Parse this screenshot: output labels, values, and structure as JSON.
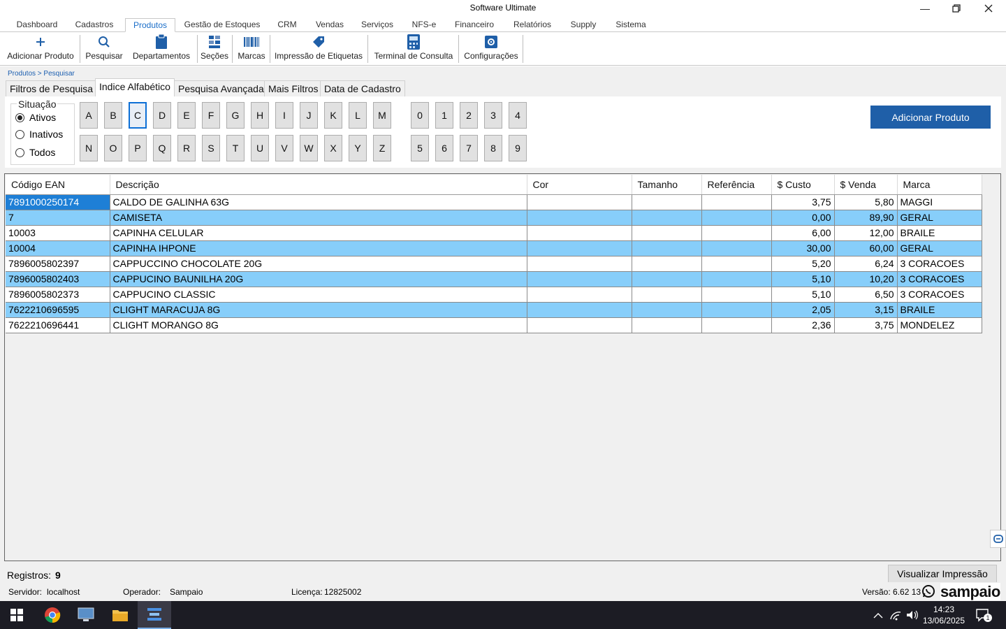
{
  "window": {
    "title": "Software Ultimate"
  },
  "menu": [
    {
      "label": "Dashboard"
    },
    {
      "label": "Cadastros"
    },
    {
      "label": "Produtos"
    },
    {
      "label": "Gestão de Estoques"
    },
    {
      "label": "CRM"
    },
    {
      "label": "Vendas"
    },
    {
      "label": "Serviços"
    },
    {
      "label": "NFS-e"
    },
    {
      "label": "Financeiro"
    },
    {
      "label": "Relatórios"
    },
    {
      "label": "Supply"
    },
    {
      "label": "Sistema"
    }
  ],
  "toolbar": [
    {
      "label": "Adicionar Produto",
      "icon": "plus-icon"
    },
    {
      "label": "Pesquisar",
      "icon": "search-icon"
    },
    {
      "label": "Departamentos",
      "icon": "clipboard-icon"
    },
    {
      "label": "Seções",
      "icon": "sections-icon"
    },
    {
      "label": "Marcas",
      "icon": "barcode-icon"
    },
    {
      "label": "Impressão de Etiquetas",
      "icon": "tag-icon"
    },
    {
      "label": "Terminal de Consulta",
      "icon": "terminal-icon"
    },
    {
      "label": "Configurações",
      "icon": "gear-icon"
    }
  ],
  "breadcrumb": "Produtos > Pesquisar",
  "subtabs": [
    {
      "label": "Filtros de Pesquisa"
    },
    {
      "label": "Indice Alfabético"
    },
    {
      "label": "Pesquisa Avançada"
    },
    {
      "label": "Mais Filtros"
    },
    {
      "label": "Data de Cadastro"
    }
  ],
  "situacao": {
    "legend": "Situação",
    "options": [
      {
        "label": "Ativos",
        "checked": true
      },
      {
        "label": "Inativos"
      },
      {
        "label": "Todos"
      }
    ]
  },
  "letters_row1": [
    "A",
    "B",
    "C",
    "D",
    "E",
    "F",
    "G",
    "H",
    "I",
    "J",
    "K",
    "L",
    "M"
  ],
  "letters_row2": [
    "N",
    "O",
    "P",
    "Q",
    "R",
    "S",
    "T",
    "U",
    "V",
    "W",
    "X",
    "Y",
    "Z"
  ],
  "digits_row1": [
    "0",
    "1",
    "2",
    "3",
    "4"
  ],
  "digits_row2": [
    "5",
    "6",
    "7",
    "8",
    "9"
  ],
  "selected_letter": "C",
  "add_button": "Adicionar Produto",
  "table": {
    "columns": [
      "Código EAN",
      "Descrição",
      "Cor",
      "Tamanho",
      "Referência",
      "$ Custo",
      "$ Venda",
      "Marca"
    ],
    "rows": [
      [
        "7891000250174",
        "CALDO DE GALINHA 63G",
        "",
        "",
        "",
        "3,75",
        "5,80",
        "MAGGI"
      ],
      [
        "7",
        "CAMISETA",
        "",
        "",
        "",
        "0,00",
        "89,90",
        "GERAL"
      ],
      [
        "10003",
        "CAPINHA CELULAR",
        "",
        "",
        "",
        "6,00",
        "12,00",
        "BRAILE"
      ],
      [
        "10004",
        "CAPINHA IHPONE",
        "",
        "",
        "",
        "30,00",
        "60,00",
        "GERAL"
      ],
      [
        "7896005802397",
        "CAPPUCCINO CHOCOLATE  20G",
        "",
        "",
        "",
        "5,20",
        "6,24",
        "3 CORACOES"
      ],
      [
        "7896005802403",
        "CAPPUCINO BAUNILHA 20G",
        "",
        "",
        "",
        "5,10",
        "10,20",
        "3 CORACOES"
      ],
      [
        "7896005802373",
        "CAPPUCINO CLASSIC",
        "",
        "",
        "",
        "5,10",
        "6,50",
        "3 CORACOES"
      ],
      [
        "7622210696595",
        "CLIGHT MARACUJA 8G",
        "",
        "",
        "",
        "2,05",
        "3,15",
        "BRAILE"
      ],
      [
        "7622210696441",
        "CLIGHT MORANGO 8G",
        "",
        "",
        "",
        "2,36",
        "3,75",
        "MONDELEZ"
      ]
    ]
  },
  "status": {
    "registros_label": "Registros:",
    "registros_count": "9",
    "print_button": "Visualizar Impressão"
  },
  "info": {
    "servidor_label": "Servidor:",
    "servidor": "localhost",
    "operador_label": "Operador:",
    "operador": "Sampaio",
    "licenca_label": "Licença:",
    "licenca": "12825002",
    "versao": "Versão: 6.62 130:",
    "brand": "sampaio"
  },
  "clock": {
    "time": "14:23",
    "date": "13/06/2025"
  },
  "notifications": "1"
}
